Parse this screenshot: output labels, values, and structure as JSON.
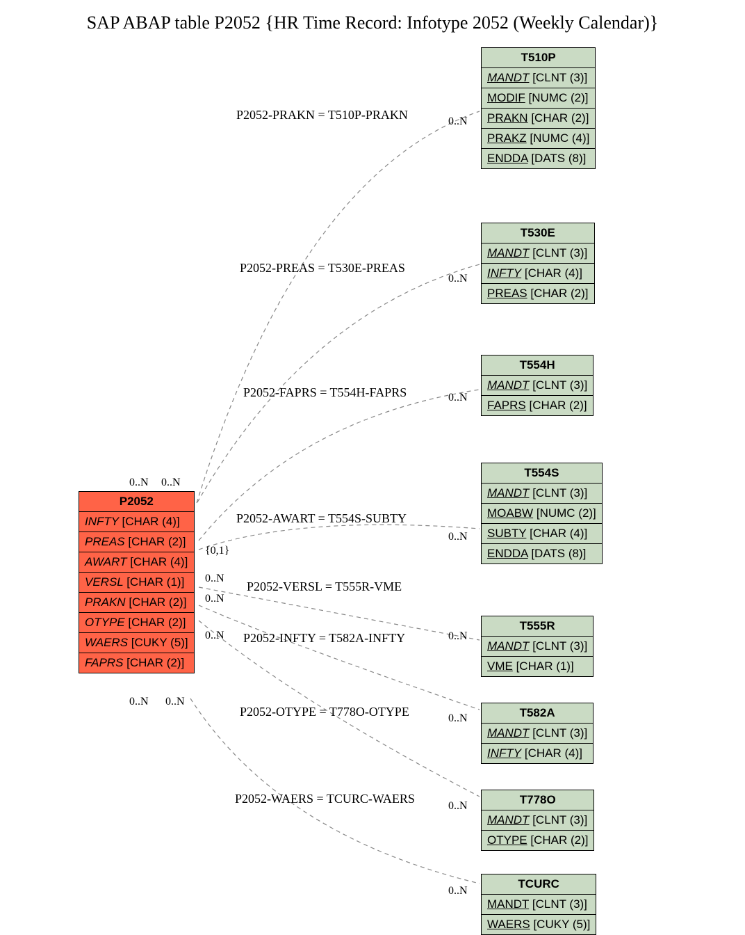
{
  "title": "SAP ABAP table P2052 {HR Time Record: Infotype 2052 (Weekly Calendar)}",
  "main": {
    "name": "P2052",
    "fields": [
      {
        "name": "INFTY",
        "type": "[CHAR (4)]"
      },
      {
        "name": "PREAS",
        "type": "[CHAR (2)]"
      },
      {
        "name": "AWART",
        "type": "[CHAR (4)]"
      },
      {
        "name": "VERSL",
        "type": "[CHAR (1)]"
      },
      {
        "name": "PRAKN",
        "type": "[CHAR (2)]"
      },
      {
        "name": "OTYPE",
        "type": "[CHAR (2)]"
      },
      {
        "name": "WAERS",
        "type": "[CUKY (5)]"
      },
      {
        "name": "FAPRS",
        "type": "[CHAR (2)]"
      }
    ]
  },
  "refs": {
    "T510P": {
      "fields": [
        {
          "name": "MANDT",
          "type": "[CLNT (3)]",
          "key": true
        },
        {
          "name": "MODIF",
          "type": "[NUMC (2)]"
        },
        {
          "name": "PRAKN",
          "type": "[CHAR (2)]"
        },
        {
          "name": "PRAKZ",
          "type": "[NUMC (4)]"
        },
        {
          "name": "ENDDA",
          "type": "[DATS (8)]"
        }
      ]
    },
    "T530E": {
      "fields": [
        {
          "name": "MANDT",
          "type": "[CLNT (3)]",
          "key": true
        },
        {
          "name": "INFTY",
          "type": "[CHAR (4)]",
          "key": true
        },
        {
          "name": "PREAS",
          "type": "[CHAR (2)]"
        }
      ]
    },
    "T554H": {
      "fields": [
        {
          "name": "MANDT",
          "type": "[CLNT (3)]",
          "key": true
        },
        {
          "name": "FAPRS",
          "type": "[CHAR (2)]"
        }
      ]
    },
    "T554S": {
      "fields": [
        {
          "name": "MANDT",
          "type": "[CLNT (3)]",
          "key": true
        },
        {
          "name": "MOABW",
          "type": "[NUMC (2)]"
        },
        {
          "name": "SUBTY",
          "type": "[CHAR (4)]"
        },
        {
          "name": "ENDDA",
          "type": "[DATS (8)]"
        }
      ]
    },
    "T555R": {
      "fields": [
        {
          "name": "MANDT",
          "type": "[CLNT (3)]",
          "key": true
        },
        {
          "name": "VME",
          "type": "[CHAR (1)]"
        }
      ]
    },
    "T582A": {
      "fields": [
        {
          "name": "MANDT",
          "type": "[CLNT (3)]",
          "key": true
        },
        {
          "name": "INFTY",
          "type": "[CHAR (4)]",
          "key": true
        }
      ]
    },
    "T778O": {
      "fields": [
        {
          "name": "MANDT",
          "type": "[CLNT (3)]",
          "key": true
        },
        {
          "name": "OTYPE",
          "type": "[CHAR (2)]"
        }
      ]
    },
    "TCURC": {
      "fields": [
        {
          "name": "MANDT",
          "type": "[CLNT (3)]"
        },
        {
          "name": "WAERS",
          "type": "[CUKY (5)]"
        }
      ]
    }
  },
  "relations": [
    {
      "label": "P2052-PRAKN = T510P-PRAKN"
    },
    {
      "label": "P2052-PREAS = T530E-PREAS"
    },
    {
      "label": "P2052-FAPRS = T554H-FAPRS"
    },
    {
      "label": "P2052-AWART = T554S-SUBTY"
    },
    {
      "label": "P2052-VERSL = T555R-VME"
    },
    {
      "label": "P2052-INFTY = T582A-INFTY"
    },
    {
      "label": "P2052-OTYPE = T778O-OTYPE"
    },
    {
      "label": "P2052-WAERS = TCURC-WAERS"
    }
  ],
  "card": {
    "zn": "0..N",
    "zo": "{0,1}"
  }
}
